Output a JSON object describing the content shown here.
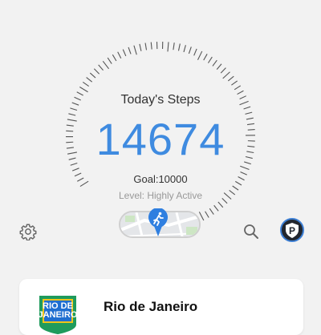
{
  "steps_card": {
    "title": "Today's Steps",
    "steps": "14674",
    "goal_text": "Goal:10000",
    "level_text": "Level: Highly Active",
    "progress_fraction": 1.0
  },
  "toolbar": {
    "settings_icon": "gear-icon",
    "search_icon": "search-icon",
    "app_badge_letter": "P"
  },
  "map_toggle": {
    "marker_icon": "running-person-icon"
  },
  "city_card": {
    "name": "Rio de Janeiro",
    "badge_line1": "RIO DE",
    "badge_line2": "JANEIRO"
  },
  "colors": {
    "accent": "#3f8be0",
    "tick_gray": "#555555",
    "tick_orange": "#e8832a",
    "background": "#f2f2f2"
  }
}
